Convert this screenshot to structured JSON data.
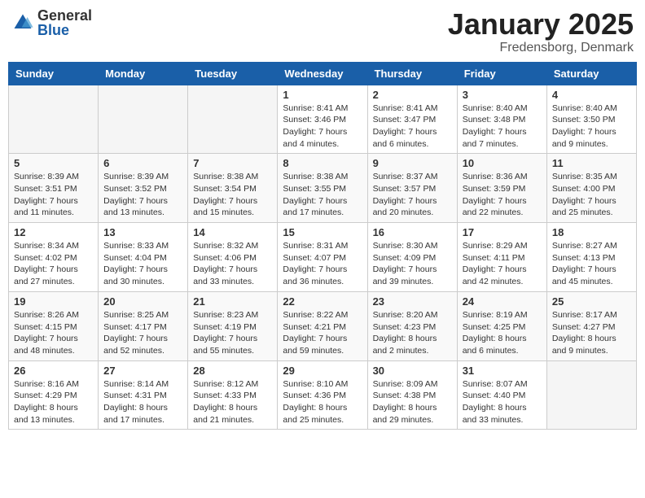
{
  "logo": {
    "general": "General",
    "blue": "Blue"
  },
  "title": "January 2025",
  "location": "Fredensborg, Denmark",
  "weekdays": [
    "Sunday",
    "Monday",
    "Tuesday",
    "Wednesday",
    "Thursday",
    "Friday",
    "Saturday"
  ],
  "weeks": [
    [
      {
        "day": "",
        "sunrise": "",
        "sunset": "",
        "daylight": ""
      },
      {
        "day": "",
        "sunrise": "",
        "sunset": "",
        "daylight": ""
      },
      {
        "day": "",
        "sunrise": "",
        "sunset": "",
        "daylight": ""
      },
      {
        "day": "1",
        "sunrise": "Sunrise: 8:41 AM",
        "sunset": "Sunset: 3:46 PM",
        "daylight": "Daylight: 7 hours and 4 minutes."
      },
      {
        "day": "2",
        "sunrise": "Sunrise: 8:41 AM",
        "sunset": "Sunset: 3:47 PM",
        "daylight": "Daylight: 7 hours and 6 minutes."
      },
      {
        "day": "3",
        "sunrise": "Sunrise: 8:40 AM",
        "sunset": "Sunset: 3:48 PM",
        "daylight": "Daylight: 7 hours and 7 minutes."
      },
      {
        "day": "4",
        "sunrise": "Sunrise: 8:40 AM",
        "sunset": "Sunset: 3:50 PM",
        "daylight": "Daylight: 7 hours and 9 minutes."
      }
    ],
    [
      {
        "day": "5",
        "sunrise": "Sunrise: 8:39 AM",
        "sunset": "Sunset: 3:51 PM",
        "daylight": "Daylight: 7 hours and 11 minutes."
      },
      {
        "day": "6",
        "sunrise": "Sunrise: 8:39 AM",
        "sunset": "Sunset: 3:52 PM",
        "daylight": "Daylight: 7 hours and 13 minutes."
      },
      {
        "day": "7",
        "sunrise": "Sunrise: 8:38 AM",
        "sunset": "Sunset: 3:54 PM",
        "daylight": "Daylight: 7 hours and 15 minutes."
      },
      {
        "day": "8",
        "sunrise": "Sunrise: 8:38 AM",
        "sunset": "Sunset: 3:55 PM",
        "daylight": "Daylight: 7 hours and 17 minutes."
      },
      {
        "day": "9",
        "sunrise": "Sunrise: 8:37 AM",
        "sunset": "Sunset: 3:57 PM",
        "daylight": "Daylight: 7 hours and 20 minutes."
      },
      {
        "day": "10",
        "sunrise": "Sunrise: 8:36 AM",
        "sunset": "Sunset: 3:59 PM",
        "daylight": "Daylight: 7 hours and 22 minutes."
      },
      {
        "day": "11",
        "sunrise": "Sunrise: 8:35 AM",
        "sunset": "Sunset: 4:00 PM",
        "daylight": "Daylight: 7 hours and 25 minutes."
      }
    ],
    [
      {
        "day": "12",
        "sunrise": "Sunrise: 8:34 AM",
        "sunset": "Sunset: 4:02 PM",
        "daylight": "Daylight: 7 hours and 27 minutes."
      },
      {
        "day": "13",
        "sunrise": "Sunrise: 8:33 AM",
        "sunset": "Sunset: 4:04 PM",
        "daylight": "Daylight: 7 hours and 30 minutes."
      },
      {
        "day": "14",
        "sunrise": "Sunrise: 8:32 AM",
        "sunset": "Sunset: 4:06 PM",
        "daylight": "Daylight: 7 hours and 33 minutes."
      },
      {
        "day": "15",
        "sunrise": "Sunrise: 8:31 AM",
        "sunset": "Sunset: 4:07 PM",
        "daylight": "Daylight: 7 hours and 36 minutes."
      },
      {
        "day": "16",
        "sunrise": "Sunrise: 8:30 AM",
        "sunset": "Sunset: 4:09 PM",
        "daylight": "Daylight: 7 hours and 39 minutes."
      },
      {
        "day": "17",
        "sunrise": "Sunrise: 8:29 AM",
        "sunset": "Sunset: 4:11 PM",
        "daylight": "Daylight: 7 hours and 42 minutes."
      },
      {
        "day": "18",
        "sunrise": "Sunrise: 8:27 AM",
        "sunset": "Sunset: 4:13 PM",
        "daylight": "Daylight: 7 hours and 45 minutes."
      }
    ],
    [
      {
        "day": "19",
        "sunrise": "Sunrise: 8:26 AM",
        "sunset": "Sunset: 4:15 PM",
        "daylight": "Daylight: 7 hours and 48 minutes."
      },
      {
        "day": "20",
        "sunrise": "Sunrise: 8:25 AM",
        "sunset": "Sunset: 4:17 PM",
        "daylight": "Daylight: 7 hours and 52 minutes."
      },
      {
        "day": "21",
        "sunrise": "Sunrise: 8:23 AM",
        "sunset": "Sunset: 4:19 PM",
        "daylight": "Daylight: 7 hours and 55 minutes."
      },
      {
        "day": "22",
        "sunrise": "Sunrise: 8:22 AM",
        "sunset": "Sunset: 4:21 PM",
        "daylight": "Daylight: 7 hours and 59 minutes."
      },
      {
        "day": "23",
        "sunrise": "Sunrise: 8:20 AM",
        "sunset": "Sunset: 4:23 PM",
        "daylight": "Daylight: 8 hours and 2 minutes."
      },
      {
        "day": "24",
        "sunrise": "Sunrise: 8:19 AM",
        "sunset": "Sunset: 4:25 PM",
        "daylight": "Daylight: 8 hours and 6 minutes."
      },
      {
        "day": "25",
        "sunrise": "Sunrise: 8:17 AM",
        "sunset": "Sunset: 4:27 PM",
        "daylight": "Daylight: 8 hours and 9 minutes."
      }
    ],
    [
      {
        "day": "26",
        "sunrise": "Sunrise: 8:16 AM",
        "sunset": "Sunset: 4:29 PM",
        "daylight": "Daylight: 8 hours and 13 minutes."
      },
      {
        "day": "27",
        "sunrise": "Sunrise: 8:14 AM",
        "sunset": "Sunset: 4:31 PM",
        "daylight": "Daylight: 8 hours and 17 minutes."
      },
      {
        "day": "28",
        "sunrise": "Sunrise: 8:12 AM",
        "sunset": "Sunset: 4:33 PM",
        "daylight": "Daylight: 8 hours and 21 minutes."
      },
      {
        "day": "29",
        "sunrise": "Sunrise: 8:10 AM",
        "sunset": "Sunset: 4:36 PM",
        "daylight": "Daylight: 8 hours and 25 minutes."
      },
      {
        "day": "30",
        "sunrise": "Sunrise: 8:09 AM",
        "sunset": "Sunset: 4:38 PM",
        "daylight": "Daylight: 8 hours and 29 minutes."
      },
      {
        "day": "31",
        "sunrise": "Sunrise: 8:07 AM",
        "sunset": "Sunset: 4:40 PM",
        "daylight": "Daylight: 8 hours and 33 minutes."
      },
      {
        "day": "",
        "sunrise": "",
        "sunset": "",
        "daylight": ""
      }
    ]
  ]
}
